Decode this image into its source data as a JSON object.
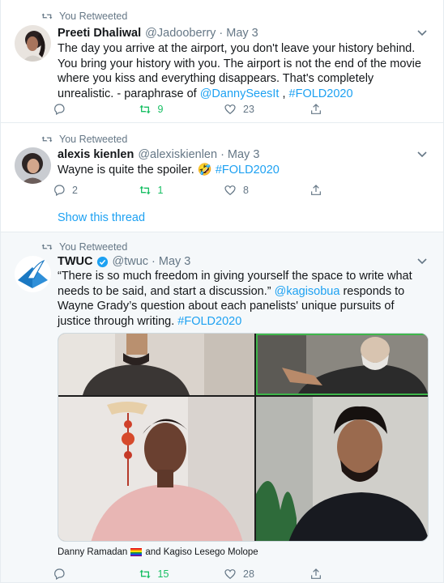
{
  "colors": {
    "accent": "#1da1f2",
    "retweet_green": "#17bf63",
    "muted": "#657786"
  },
  "tweets": [
    {
      "retweeted_by_label": "You Retweeted",
      "name": "Preeti Dhaliwal",
      "handle": "@Jadooberry",
      "dot": "·",
      "date": "May 3",
      "text_plain": "The day you arrive at the airport, you don't leave your history behind. You bring your history with you. The airport is not the end of the movie where you kiss and everything disappears. That's completely unrealistic. - paraphrase of ",
      "mention": "@DannySeesIt",
      "text_sep": " , ",
      "hashtag": "#FOLD2020",
      "replies": "",
      "retweets": "9",
      "likes": "23"
    },
    {
      "retweeted_by_label": "You Retweeted",
      "name": "alexis kienlen",
      "handle": "@alexiskienlen",
      "dot": "·",
      "date": "May 3",
      "text_plain": "Wayne is quite the spoiler. ",
      "emoji": "🤣",
      "hashtag": "#FOLD2020",
      "replies": "2",
      "retweets": "1",
      "likes": "8",
      "show_thread": "Show this thread"
    },
    {
      "retweeted_by_label": "You Retweeted",
      "name": "TWUC",
      "handle": "@twuc",
      "dot": "·",
      "date": "May 3",
      "verified_icon": "verified-badge-icon",
      "text_part1": "“There is so much freedom in giving yourself the space to write what needs to be said, and start a discussion.” ",
      "mention": "@kagisobua",
      "text_part2": " responds to Wayne Grady’s question about each panelists' unique pursuits of justice through writing. ",
      "hashtag": "#FOLD2020",
      "media_caption_1": "Danny Ramadan",
      "media_caption_2": "and Kagiso Lesego Molope",
      "replies": "",
      "retweets": "15",
      "likes": "28"
    }
  ]
}
